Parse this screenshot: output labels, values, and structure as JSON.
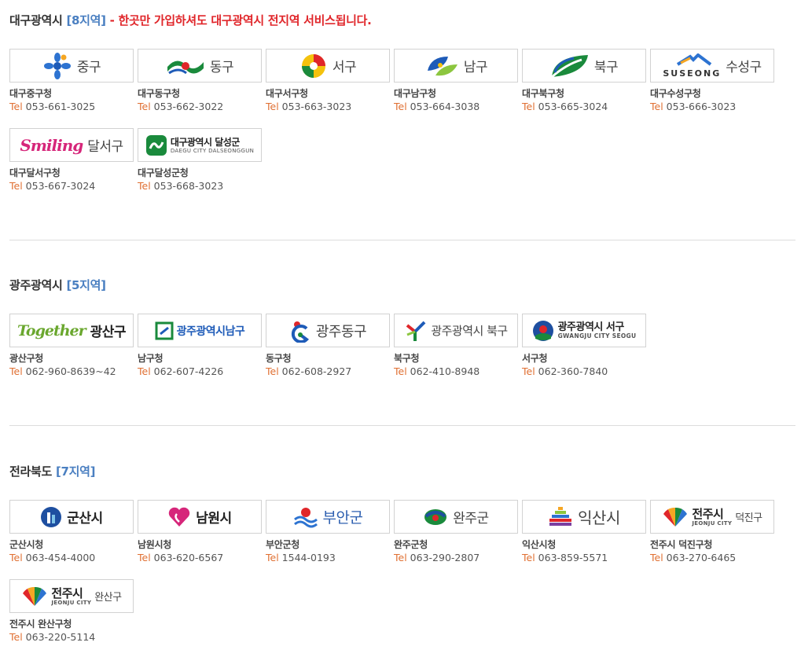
{
  "sections": [
    {
      "region": "대구광역시",
      "count": "[8지역]",
      "note": " - 한곳만 가입하셔도 대구광역시 전지역 서비스됩니다.",
      "items": [
        {
          "logo_text": "중구",
          "icon": "daegu-junggu-flower-icon",
          "office": "대구중구청",
          "tel_label": "Tel",
          "phone": "053-661-3025"
        },
        {
          "logo_text": "동구",
          "icon": "daegu-donggu-wave-icon",
          "office": "대구동구청",
          "tel_label": "Tel",
          "phone": "053-662-3022"
        },
        {
          "logo_text": "서구",
          "icon": "daegu-seogu-circle-icon",
          "office": "대구서구청",
          "tel_label": "Tel",
          "phone": "053-663-3023"
        },
        {
          "logo_text": "남구",
          "icon": "daegu-namgu-leaf-icon",
          "office": "대구남구청",
          "tel_label": "Tel",
          "phone": "053-664-3038"
        },
        {
          "logo_text": "북구",
          "icon": "daegu-bukgu-leaf-icon",
          "office": "대구북구청",
          "tel_label": "Tel",
          "phone": "053-665-3024"
        },
        {
          "logo_text": "수성구",
          "logo_sub": "SUSEONG",
          "icon": "daegu-suseong-mountain-icon",
          "office": "대구수성구청",
          "tel_label": "Tel",
          "phone": "053-666-3023"
        },
        {
          "logo_text": "달서구",
          "logo_sub": "Smiling",
          "icon": "daegu-dalseo-smiling-icon",
          "office": "대구달서구청",
          "tel_label": "Tel",
          "phone": "053-667-3024"
        },
        {
          "logo_text": "대구광역시 달성군",
          "logo_sub": "DAEGU CITY DALSEONGGUN",
          "icon": "daegu-dalseong-emblem-icon",
          "office": "대구달성군청",
          "tel_label": "Tel",
          "phone": "053-668-3023"
        }
      ]
    },
    {
      "region": "광주광역시",
      "count": "[5지역]",
      "note": "",
      "items": [
        {
          "logo_text": "광산구",
          "logo_sub": "Together",
          "icon": "gwangju-gwangsan-together-icon",
          "office": "광산구청",
          "tel_label": "Tel",
          "phone": "062-960-8639~42"
        },
        {
          "logo_text": "광주광역시남구",
          "icon": "gwangju-namgu-emblem-icon",
          "office": "남구청",
          "tel_label": "Tel",
          "phone": "062-607-4226"
        },
        {
          "logo_text": "광주동구",
          "icon": "gwangju-donggu-emblem-icon",
          "office": "동구청",
          "tel_label": "Tel",
          "phone": "062-608-2927"
        },
        {
          "logo_text": "광주광역시 북구",
          "icon": "gwangju-bukgu-emblem-icon",
          "office": "북구청",
          "tel_label": "Tel",
          "phone": "062-410-8948"
        },
        {
          "logo_text": "광주광역시 서구",
          "logo_sub": "GWANGJU CITY SEOGU",
          "icon": "gwangju-seogu-emblem-icon",
          "office": "서구청",
          "tel_label": "Tel",
          "phone": "062-360-7840"
        }
      ]
    },
    {
      "region": "전라북도",
      "count": "[7지역]",
      "note": "",
      "items": [
        {
          "logo_text": "군산시",
          "icon": "gunsan-emblem-icon",
          "office": "군산시청",
          "tel_label": "Tel",
          "phone": "063-454-4000"
        },
        {
          "logo_text": "남원시",
          "icon": "namwon-heart-icon",
          "office": "남원시청",
          "tel_label": "Tel",
          "phone": "063-620-6567"
        },
        {
          "logo_text": "부안군",
          "icon": "buan-wave-icon",
          "office": "부안군청",
          "tel_label": "Tel",
          "phone": "1544-0193"
        },
        {
          "logo_text": "완주군",
          "icon": "wanju-emblem-icon",
          "office": "완주군청",
          "tel_label": "Tel",
          "phone": "063-290-2807"
        },
        {
          "logo_text": "익산시",
          "icon": "iksan-emblem-icon",
          "office": "익산시청",
          "tel_label": "Tel",
          "phone": "063-859-5571"
        },
        {
          "logo_text": "전주시",
          "logo_sub": "JEONJU CITY",
          "logo_extra": "덕진구",
          "icon": "jeonju-fan-icon",
          "office": "전주시 덕진구청",
          "tel_label": "Tel",
          "phone": "063-270-6465"
        },
        {
          "logo_text": "전주시",
          "logo_sub": "JEONJU CITY",
          "logo_extra": "완산구",
          "icon": "jeonju-fan-icon",
          "office": "전주시 완산구청",
          "tel_label": "Tel",
          "phone": "063-220-5114"
        }
      ]
    }
  ]
}
